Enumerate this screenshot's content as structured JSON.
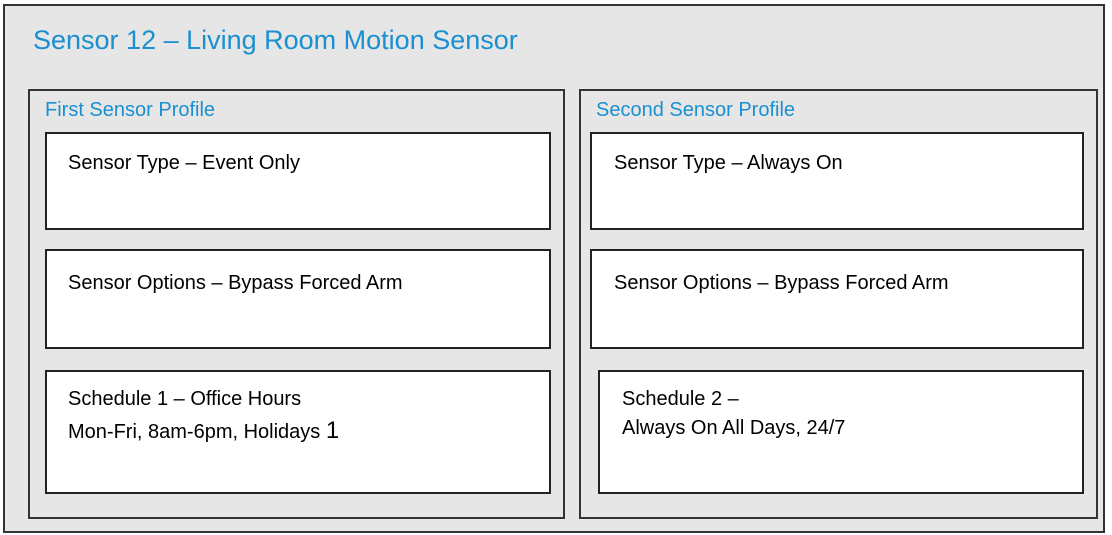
{
  "title": "Sensor 12 – Living Room Motion Sensor",
  "profiles": [
    {
      "heading": "First Sensor Profile",
      "sensor_type": "Sensor Type – Event Only",
      "sensor_options": "Sensor Options – Bypass Forced Arm",
      "schedule_line1": "Schedule 1 – Office Hours",
      "schedule_line2": "Mon-Fri, 8am-6pm, Holidays ",
      "schedule_line2_suffix": "1"
    },
    {
      "heading": "Second Sensor Profile",
      "sensor_type": "Sensor Type – Always On",
      "sensor_options": "Sensor Options – Bypass Forced Arm",
      "schedule_line1": "Schedule 2 –",
      "schedule_line2": "Always On All Days, 24/7"
    }
  ],
  "colors": {
    "title_blue": "#1a8fd1",
    "panel_gray": "#e6e6e6",
    "card_white": "#ffffff"
  }
}
